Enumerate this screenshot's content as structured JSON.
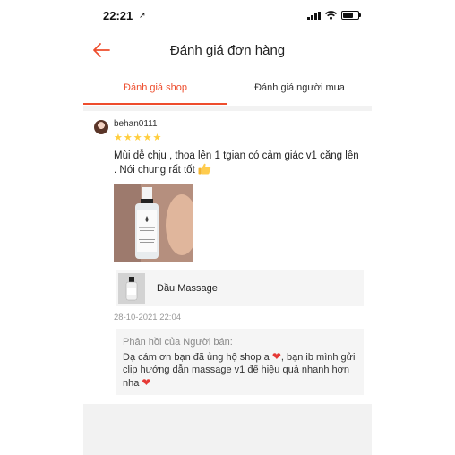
{
  "status_bar": {
    "time": "22:21",
    "location_glyph": "↗"
  },
  "header": {
    "title": "Đánh giá đơn hàng",
    "back_icon": "back-arrow-icon"
  },
  "tabs": [
    {
      "label": "Đánh giá shop",
      "active": true
    },
    {
      "label": "Đánh giá người mua",
      "active": false
    }
  ],
  "review": {
    "username": "behan0111",
    "rating": 5,
    "comment": "Mùi dễ chịu , thoa lên 1 tgian có cảm giác v1 căng lên . Nói chung rất tốt",
    "product_name": "Dầu Massage",
    "date": "28-10-2021 22:04"
  },
  "reply": {
    "label": "Phản hồi của Người bán:",
    "text_1": "Dạ cám ơn bạn đã ủng hộ shop a",
    "text_2": ", bạn ib mình gửi clip hướng dẫn massage v1 để hiệu quả nhanh hơn nha",
    "heart_glyph": "❤"
  },
  "colors": {
    "accent": "#ee4d2d",
    "star": "#ffce3d",
    "heart": "#e53935"
  }
}
